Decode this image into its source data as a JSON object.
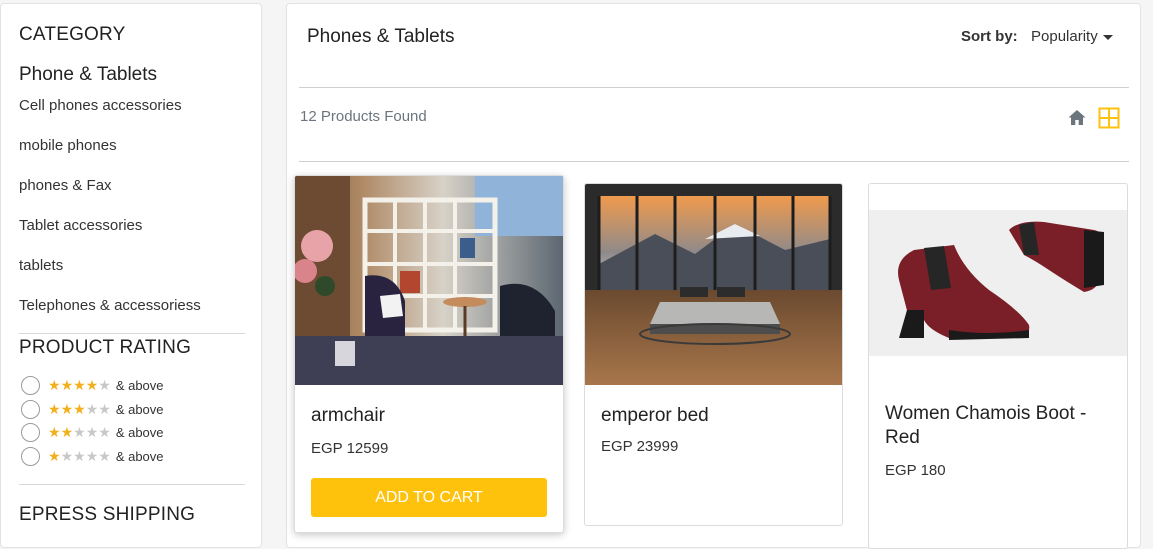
{
  "sidebar": {
    "category_heading": "CATEGORY",
    "category_title": "Phone & Tablets",
    "categories": [
      "Cell phones accessories",
      "mobile phones",
      "phones & Fax",
      "Tablet accessories",
      "tablets",
      "Telephones & accessoriess"
    ],
    "rating_heading": "PRODUCT RATING",
    "ratings": [
      {
        "stars": 4,
        "label": "& above"
      },
      {
        "stars": 3,
        "label": "& above"
      },
      {
        "stars": 2,
        "label": "& above"
      },
      {
        "stars": 1,
        "label": "& above"
      }
    ],
    "shipping_heading": "EPRESS SHIPPING"
  },
  "main": {
    "title": "Phones & Tablets",
    "sort_label": "Sort by:",
    "sort_value": "Popularity",
    "products_found": "12 Products Found",
    "view_icons": [
      "home-icon",
      "grid-view-icon"
    ],
    "accent_color": "#fec20c"
  },
  "products": [
    {
      "name": "armchair",
      "price": "EGP 12599",
      "button": "ADD TO CART",
      "image": "armchair-photo"
    },
    {
      "name": "emperor bed",
      "price": "EGP 23999",
      "image": "bed-photo"
    },
    {
      "name": "Women Chamois Boot - Red",
      "price": "EGP 180",
      "image": "boots-photo"
    }
  ]
}
